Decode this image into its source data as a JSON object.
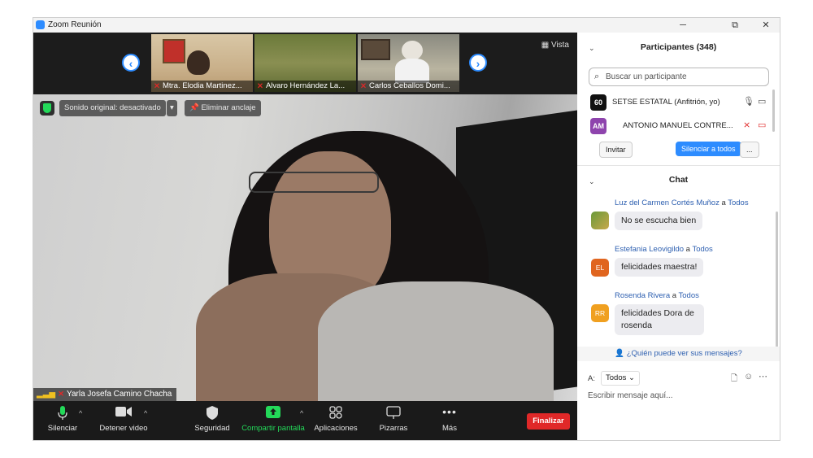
{
  "window": {
    "title": "Zoom Reunión",
    "controls": [
      "─",
      "⧉",
      "✕"
    ]
  },
  "thumbnails": [
    {
      "name": "Mtra. Elodia Martinez...",
      "muted": true
    },
    {
      "name": "Alvaro Hernández La...",
      "muted": true
    },
    {
      "name": "Carlos Ceballos Domi...",
      "muted": true
    }
  ],
  "view_label": "Vista",
  "audio": {
    "original_sound": "Sonido original: desactivado",
    "unpin": "Eliminar anclaje"
  },
  "active_speaker": {
    "name": "Yarla Josefa Camino Chacha"
  },
  "toolbar": {
    "mute": "Silenciar",
    "video": "Detener video",
    "security": "Seguridad",
    "share": "Compartir pantalla",
    "apps": "Aplicaciones",
    "whiteboards": "Pizarras",
    "more": "Más",
    "end": "Finalizar"
  },
  "participants": {
    "header": "Participantes (348)",
    "search_placeholder": "Buscar un participante",
    "list": [
      {
        "avatar": "60",
        "name": "SETSE ESTATAL (Anfitrión, yo)",
        "color": "#1a1a1a"
      },
      {
        "avatar": "AM",
        "name": "ANTONIO MANUEL CONTRE...",
        "color": "#8e44ad"
      }
    ],
    "invite": "Invitar",
    "mute_all": "Silenciar a todos",
    "more": "..."
  },
  "chat": {
    "header": "Chat",
    "messages": [
      {
        "from": "Luz del Carmen Cortés Muñoz",
        "to_word": " a ",
        "to": "Todos",
        "text": "No se escucha bien",
        "avatar": "",
        "color": "#c8a84a"
      },
      {
        "from": "Estefania Leovigildo",
        "to_word": " a ",
        "to": "Todos",
        "text": "felicidades maestra!",
        "avatar": "EL",
        "color": "#e0651f"
      },
      {
        "from": "Rosenda Rivera",
        "to_word": " a ",
        "to": "Todos",
        "text": "felicidades Dora de rosenda",
        "avatar": "RR",
        "color": "#f0a020"
      }
    ],
    "who_can_see": "¿Quién puede ver sus mensajes?",
    "to_label": "A:",
    "to_value": "Todos",
    "input_placeholder": "Escribir mensaje aquí..."
  },
  "colors": {
    "accent": "#2d8cff",
    "end": "#e02828",
    "share": "#23d959"
  }
}
